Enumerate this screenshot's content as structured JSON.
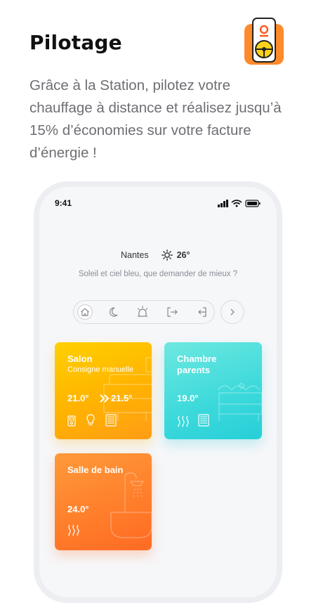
{
  "header": {
    "title": "Pilotage",
    "app_icon": "phone-steering-wheel-icon"
  },
  "description": "Grâce à la Station, pilotez votre chauffage à distance et réalisez jusqu’à 15% d’économies sur votre facture d’énergie !",
  "status_bar": {
    "time": "9:41"
  },
  "weather": {
    "city": "Nantes",
    "temperature": "26°",
    "message": "Soleil et ciel bleu, que demander de mieux ?",
    "icon": "sun-icon"
  },
  "modes": [
    {
      "icon": "home-icon"
    },
    {
      "icon": "moon-icon"
    },
    {
      "icon": "alarm-light-icon"
    },
    {
      "icon": "exit-icon"
    },
    {
      "icon": "enter-icon"
    }
  ],
  "rooms": {
    "salon": {
      "name": "Salon",
      "mode": "Consigne manuelle",
      "current": "21.0°",
      "target": "21.5°"
    },
    "chambre": {
      "name_line1": "Chambre",
      "name_line2": "parents",
      "current": "19.0°"
    },
    "sdb": {
      "name": "Salle de bain",
      "current": "24.0°"
    }
  },
  "colors": {
    "salon": "#ffb300",
    "chambre": "#3cd9db",
    "sdb": "#ff7d2a",
    "accent": "#ff6a24"
  }
}
